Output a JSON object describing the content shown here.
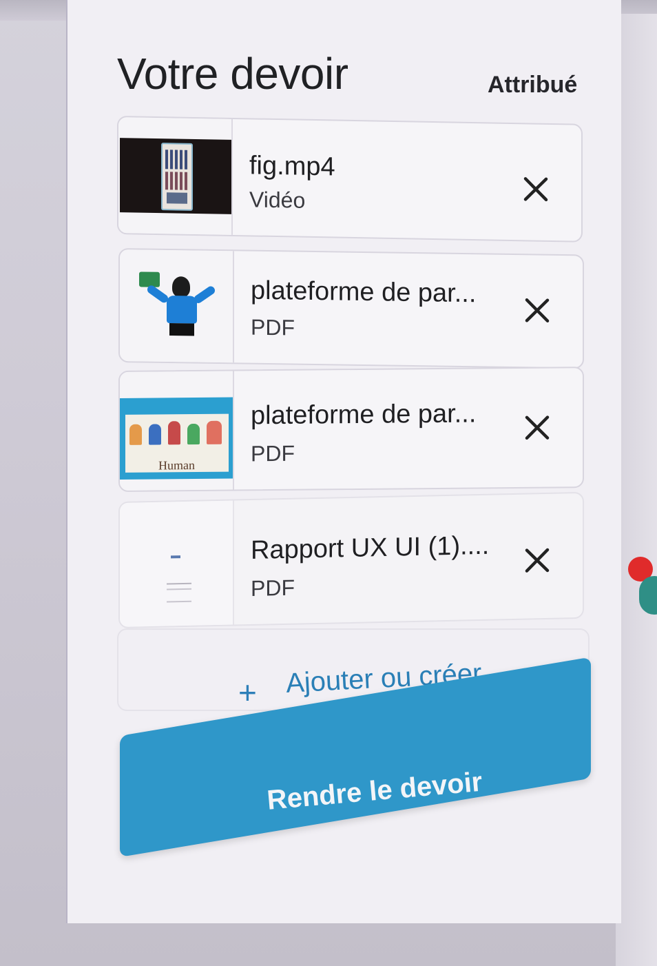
{
  "assignment": {
    "title": "Votre devoir",
    "status": "Attribué"
  },
  "attachments": [
    {
      "name": "fig.mp4",
      "type": "Vidéo",
      "thumbnail": "video-thumbnail"
    },
    {
      "name": "plateforme de par...",
      "type": "PDF",
      "thumbnail": "woman-illustration-thumbnail"
    },
    {
      "name": "plateforme de par...",
      "type": "PDF",
      "thumbnail": "human-people-thumbnail"
    },
    {
      "name": "Rapport UX UI (1)....",
      "type": "PDF",
      "thumbnail": "document-thumbnail"
    }
  ],
  "add": {
    "icon": "plus-icon",
    "label": "Ajouter ou créer"
  },
  "submit": {
    "label": "Rendre le devoir"
  },
  "colors": {
    "accent": "#2f97c9",
    "link": "#2a7fb6",
    "notification": "#e02b2b"
  }
}
